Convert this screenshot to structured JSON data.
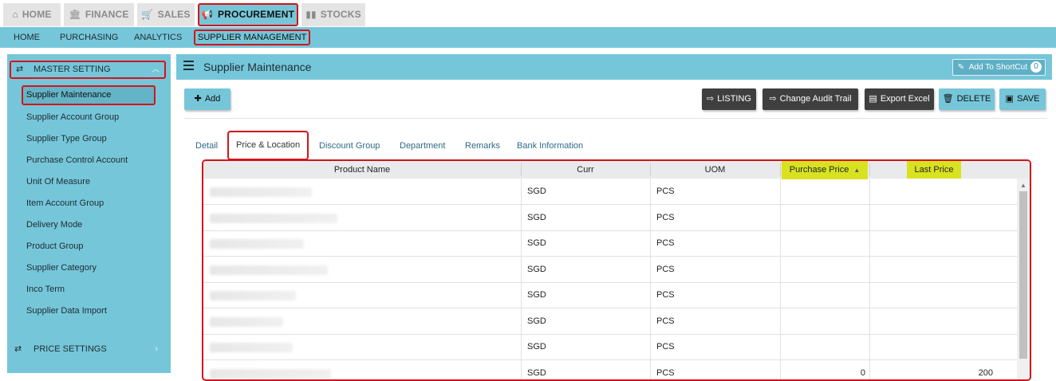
{
  "top_tabs": [
    {
      "label": "HOME",
      "icon": "home-icon"
    },
    {
      "label": "FINANCE",
      "icon": "bank-icon"
    },
    {
      "label": "SALES",
      "icon": "cart-icon"
    },
    {
      "label": "PROCUREMENT",
      "icon": "megaphone-icon",
      "active": true
    },
    {
      "label": "STOCKS",
      "icon": "bar-chart-icon"
    }
  ],
  "sub_nav": [
    "HOME",
    "PURCHASING",
    "ANALYTICS",
    "SUPPLIER MANAGEMENT"
  ],
  "sidebar": {
    "section": "MASTER SETTING",
    "items": [
      "Supplier Maintenance",
      "Supplier Account Group",
      "Supplier Type Group",
      "Purchase Control Account",
      "Unit Of Measure",
      "Item Account Group",
      "Delivery Mode",
      "Product Group",
      "Supplier Category",
      "Inco Term",
      "Supplier Data Import"
    ],
    "footer_section": "PRICE SETTINGS"
  },
  "panel": {
    "title": "Supplier Maintenance",
    "shortcut_label": "Add To ShortCut",
    "shortcut_count": "0"
  },
  "toolbar": {
    "add": "Add",
    "listing": "LISTING",
    "audit": "Change Audit Trail",
    "export": "Export Excel",
    "delete": "DELETE",
    "save": "SAVE"
  },
  "detail_tabs": [
    "Detail",
    "Price & Location",
    "Discount Group",
    "Department",
    "Remarks",
    "Bank Information"
  ],
  "grid": {
    "columns": [
      "Product Name",
      "Curr",
      "UOM",
      "Purchase Price",
      "Last Price"
    ],
    "rows": [
      {
        "curr": "SGD",
        "uom": "PCS",
        "purchase_price": "",
        "last_price": ""
      },
      {
        "curr": "SGD",
        "uom": "PCS",
        "purchase_price": "",
        "last_price": ""
      },
      {
        "curr": "SGD",
        "uom": "PCS",
        "purchase_price": "",
        "last_price": ""
      },
      {
        "curr": "SGD",
        "uom": "PCS",
        "purchase_price": "",
        "last_price": ""
      },
      {
        "curr": "SGD",
        "uom": "PCS",
        "purchase_price": "",
        "last_price": ""
      },
      {
        "curr": "SGD",
        "uom": "PCS",
        "purchase_price": "",
        "last_price": ""
      },
      {
        "curr": "SGD",
        "uom": "PCS",
        "purchase_price": "",
        "last_price": ""
      },
      {
        "curr": "SGD",
        "uom": "PCS",
        "purchase_price": "0",
        "last_price": "200"
      }
    ]
  },
  "colors": {
    "accent": "#76c6d9",
    "highlight": "#d3141a",
    "header_highlight": "#d9e221"
  }
}
